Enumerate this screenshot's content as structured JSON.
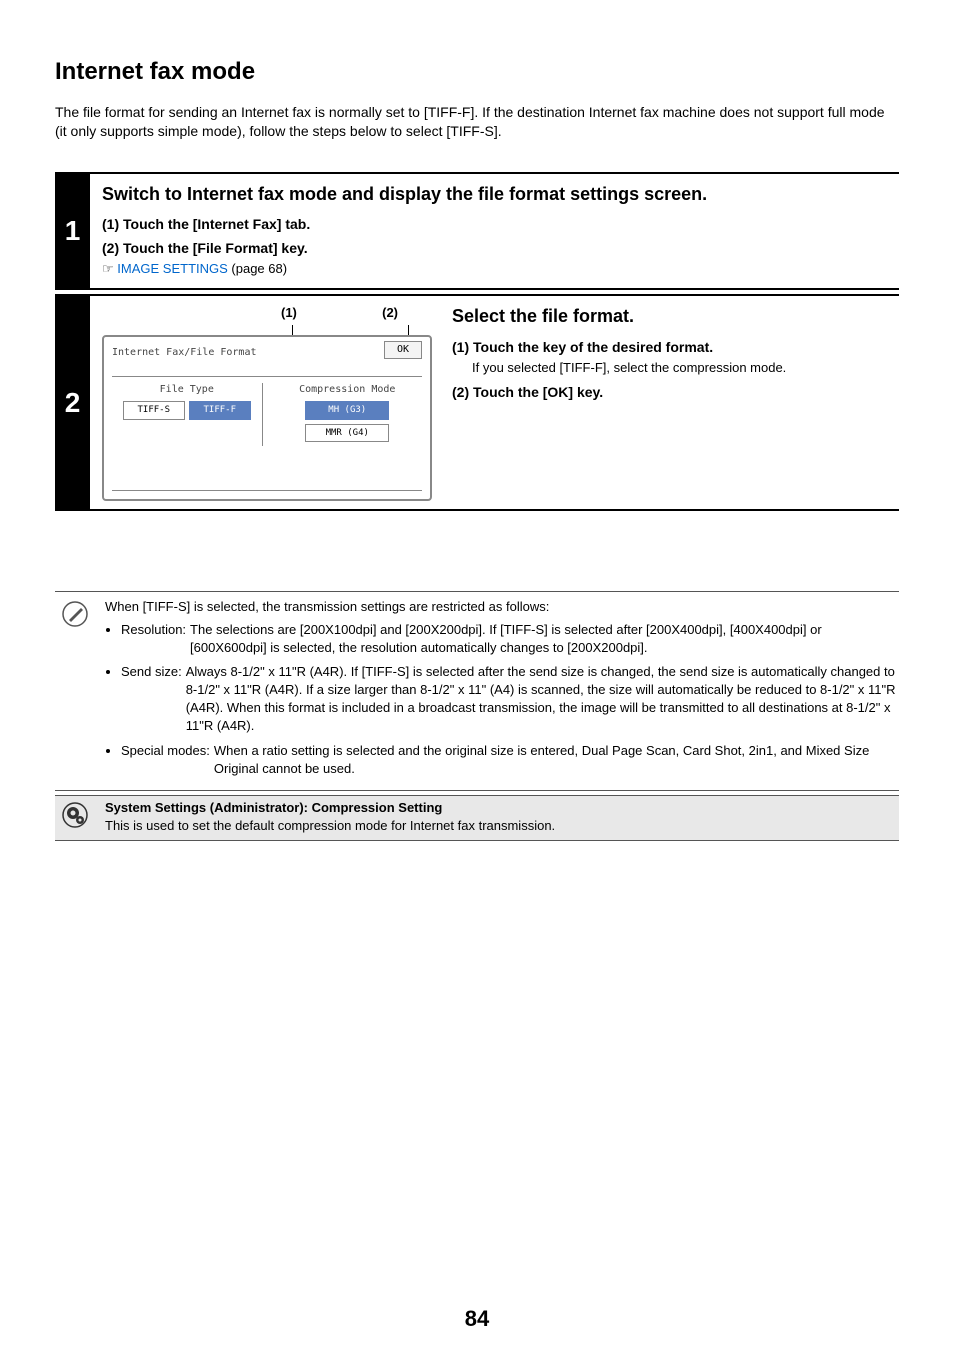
{
  "page_number": "84",
  "title": "Internet fax mode",
  "intro": "The file format for sending an Internet fax is normally set to [TIFF-F]. If the destination Internet fax machine does not support full mode (it only supports simple mode), follow the steps below to select [TIFF-S].",
  "step1": {
    "number": "1",
    "heading": "Switch to Internet fax mode and display the file format settings screen.",
    "sub1_num": "(1)",
    "sub1_text": "Touch the [Internet Fax] tab.",
    "sub2_num": "(2)",
    "sub2_text": "Touch the [File Format] key.",
    "pointer": "☞",
    "link_text": "IMAGE SETTINGS",
    "link_suffix": " (page 68)"
  },
  "step2": {
    "number": "2",
    "heading": "Select the file format.",
    "sub1_num": "(1)",
    "sub1_text": "Touch the key of the desired format.",
    "sub1_desc": "If you selected [TIFF-F], select the compression mode.",
    "sub2_num": "(2)",
    "sub2_text": "Touch the [OK] key.",
    "callout1": "(1)",
    "callout2": "(2)"
  },
  "panel": {
    "title": "Internet Fax/File Format",
    "ok": "OK",
    "file_type_label": "File Type",
    "tiff_s": "TIFF-S",
    "tiff_f": "TIFF-F",
    "comp_label": "Compression Mode",
    "mh": "MH (G3)",
    "mmr": "MMR (G4)"
  },
  "note1": {
    "intro": "When [TIFF-S] is selected, the transmission settings are restricted as follows:",
    "bullet1_label": "Resolution:",
    "bullet1_body": "The selections are [200X100dpi] and [200X200dpi]. If [TIFF-S] is selected after [200X400dpi], [400X400dpi] or [600X600dpi] is selected, the resolution automatically changes to [200X200dpi].",
    "bullet2_label": "Send size:",
    "bullet2_body": "Always 8-1/2\" x 11\"R (A4R). If [TIFF-S] is selected after the send size is changed, the send size is automatically changed to 8-1/2\" x 11\"R (A4R). If a size larger than 8-1/2\" x 11\" (A4) is scanned, the size will automatically be reduced to 8-1/2\" x 11\"R (A4R). When this format is included in a broadcast transmission, the image will be transmitted to all destinations at 8-1/2\" x 11\"R (A4R).",
    "bullet3_label": "Special modes:",
    "bullet3_body": "When a ratio setting is selected and the original size is entered, Dual Page Scan, Card Shot, 2in1, and Mixed Size Original cannot be used."
  },
  "note2": {
    "heading": "System Settings (Administrator): Compression Setting",
    "body": "This is used to set the default compression mode for Internet fax transmission."
  }
}
